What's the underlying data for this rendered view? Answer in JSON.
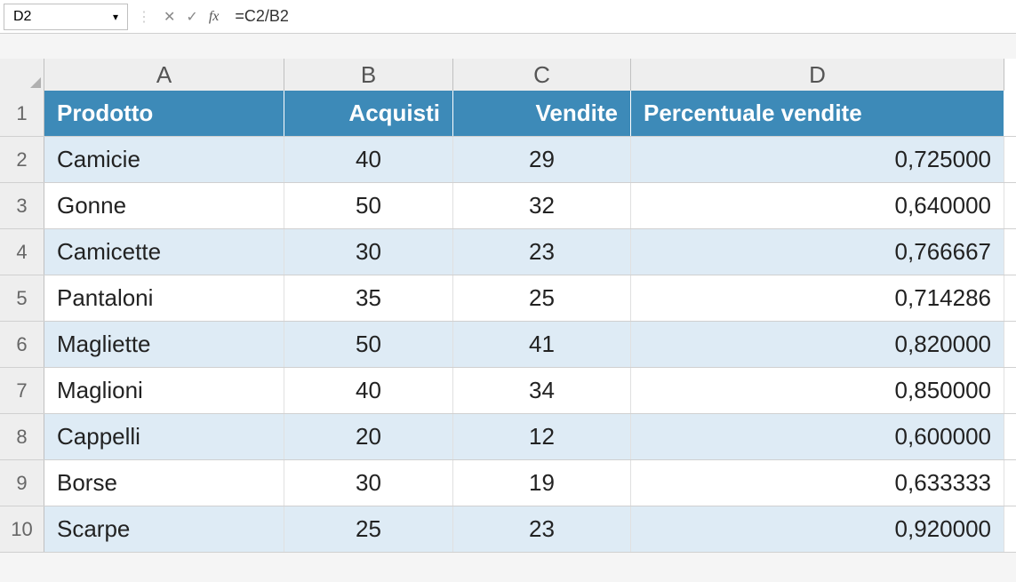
{
  "formula_bar": {
    "name_box": "D2",
    "fx_label": "fx",
    "formula": "=C2/B2"
  },
  "columns": {
    "A": "A",
    "B": "B",
    "C": "C",
    "D": "D"
  },
  "row_numbers": [
    "1",
    "2",
    "3",
    "4",
    "5",
    "6",
    "7",
    "8",
    "9",
    "10"
  ],
  "headers": {
    "prodotto": "Prodotto",
    "acquisti": "Acquisti",
    "vendite": "Vendite",
    "percentuale": "Percentuale vendite"
  },
  "rows": [
    {
      "prodotto": "Camicie",
      "acquisti": "40",
      "vendite": "29",
      "pct": "0,725000"
    },
    {
      "prodotto": "Gonne",
      "acquisti": "50",
      "vendite": "32",
      "pct": "0,640000"
    },
    {
      "prodotto": "Camicette",
      "acquisti": "30",
      "vendite": "23",
      "pct": "0,766667"
    },
    {
      "prodotto": "Pantaloni",
      "acquisti": "35",
      "vendite": "25",
      "pct": "0,714286"
    },
    {
      "prodotto": "Magliette",
      "acquisti": "50",
      "vendite": "41",
      "pct": "0,820000"
    },
    {
      "prodotto": "Maglioni",
      "acquisti": "40",
      "vendite": "34",
      "pct": "0,850000"
    },
    {
      "prodotto": "Cappelli",
      "acquisti": "20",
      "vendite": "12",
      "pct": "0,600000"
    },
    {
      "prodotto": "Borse",
      "acquisti": "30",
      "vendite": "19",
      "pct": "0,633333"
    },
    {
      "prodotto": "Scarpe",
      "acquisti": "25",
      "vendite": "23",
      "pct": "0,920000"
    }
  ]
}
